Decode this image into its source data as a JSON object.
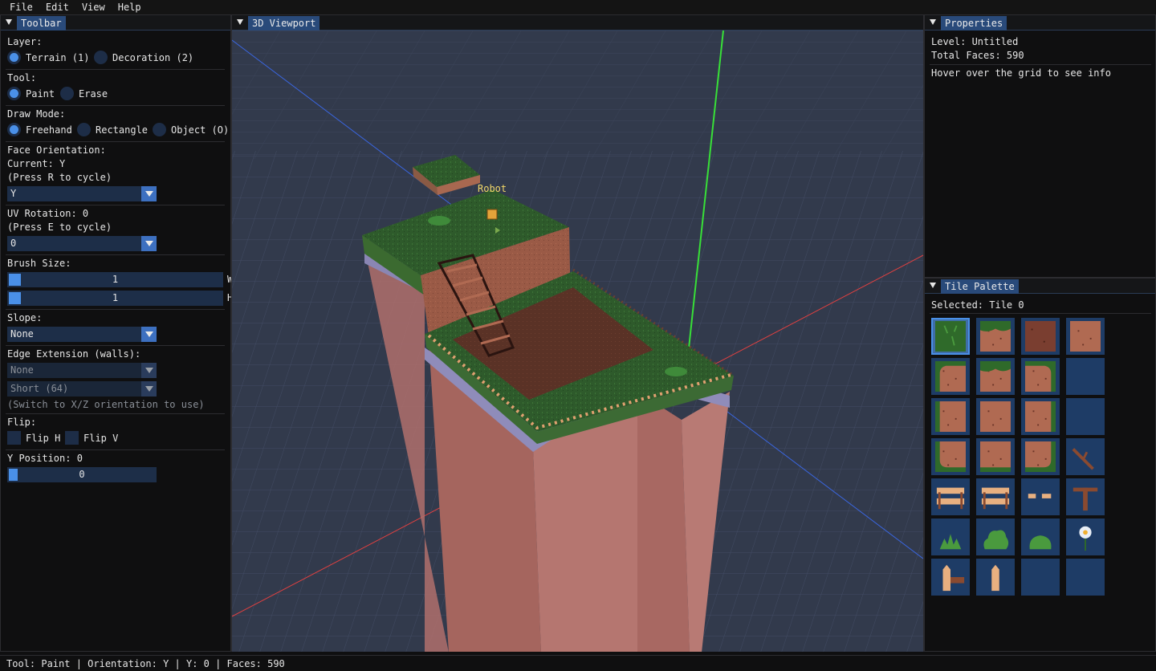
{
  "menu": {
    "file": "File",
    "edit": "Edit",
    "view": "View",
    "help": "Help"
  },
  "toolbar": {
    "title": "Toolbar",
    "layer_label": "Layer:",
    "layer_terrain": "Terrain (1)",
    "layer_decoration": "Decoration (2)",
    "tool_label": "Tool:",
    "tool_paint": "Paint",
    "tool_erase": "Erase",
    "draw_mode_label": "Draw Mode:",
    "mode_freehand": "Freehand",
    "mode_rectangle": "Rectangle",
    "mode_object": "Object (O)",
    "face_orientation_label": "Face Orientation:",
    "face_current": "Current: Y",
    "face_hint": "(Press R to cycle)",
    "face_value": "Y",
    "uv_rotation_label": "UV Rotation: 0",
    "uv_hint": "(Press E to cycle)",
    "uv_value": "0",
    "brush_size_label": "Brush Size:",
    "brush_w": "1",
    "brush_w_label": "W",
    "brush_h": "1",
    "brush_h_label": "H",
    "slope_label": "Slope:",
    "slope_value": "None",
    "edge_label": "Edge Extension (walls):",
    "edge_value": "None",
    "edge_height": "Short (64)",
    "edge_hint": "(Switch to X/Z orientation to use)",
    "flip_label": "Flip:",
    "flip_h": "Flip H",
    "flip_v": "Flip V",
    "ypos_label": "Y Position: 0",
    "ypos_value": "0"
  },
  "viewport": {
    "title": "3D Viewport",
    "robot_label": "Robot"
  },
  "properties": {
    "title": "Properties",
    "level": "Level: Untitled",
    "faces": "Total Faces: 590",
    "hover_info": "Hover over the grid to see info"
  },
  "palette": {
    "title": "Tile Palette",
    "selected": "Selected: Tile 0",
    "tiles": [
      "grass-tile",
      "grass-dirt-top-tile",
      "dark-dirt-tile",
      "dirt-tile",
      "grass-dirt-corner-tl-tile",
      "grass-dirt-top-tile",
      "grass-dirt-corner-tr-tile",
      "empty-tile",
      "grass-dirt-left-tile",
      "dirt-tile",
      "grass-dirt-right-tile",
      "empty-tile",
      "grass-dirt-corner-bl-tile",
      "grass-dirt-bottom-tile",
      "grass-dirt-corner-br-tile",
      "branch-tile",
      "fence-tile",
      "fence-tile",
      "fence-rail-tile",
      "post-tile",
      "grass-tuft-tile",
      "bush-tile",
      "bush-small-tile",
      "flower-tile",
      "fence-post-left-tile",
      "fence-post-tile",
      "empty-tile",
      "empty-tile"
    ]
  },
  "status": "Tool: Paint | Orientation: Y | Y: 0 | Faces: 590",
  "colors": {
    "accent": "#4a90e8",
    "tab": "#294a7a",
    "frame": "#1d2e48",
    "viewport_bg": "#323a4c",
    "axis_x": "#e04040",
    "axis_y": "#38e038",
    "axis_z": "#3a66e0",
    "grass": "#2d5a2a",
    "dirt": "#a05a42"
  }
}
